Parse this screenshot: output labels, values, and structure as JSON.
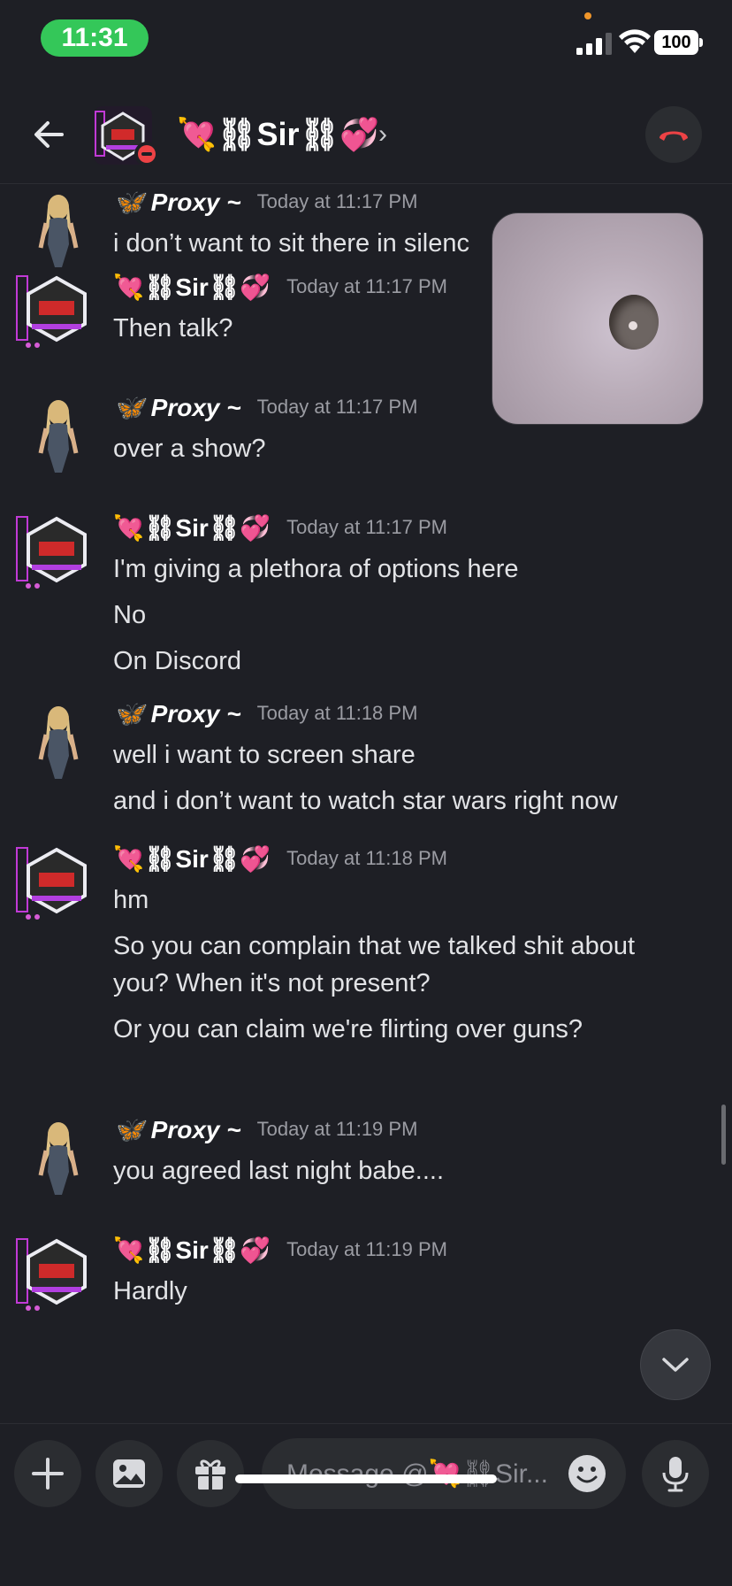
{
  "status_bar": {
    "time": "11:31",
    "battery": "100"
  },
  "header": {
    "title": "💘⛓Sir⛓💞",
    "chevron": "›"
  },
  "colors": {
    "background": "#1e1f25",
    "time_pill": "#34c759",
    "hangup": "#ed4245",
    "surface": "#2b2d31"
  },
  "messages": [
    {
      "user": "🦋 Proxy ~",
      "time": "Today at 11:17 PM",
      "lines": [
        "i don’t want to sit there in silenc"
      ]
    },
    {
      "user": "💘⛓Sir⛓💞",
      "time": "Today at 11:17 PM",
      "lines": [
        "Then talk?"
      ]
    },
    {
      "user": "🦋 Proxy ~",
      "time": "Today at 11:17 PM",
      "lines": [
        "over a show?"
      ]
    },
    {
      "user": "💘⛓Sir⛓💞",
      "time": "Today at 11:17 PM",
      "lines": [
        "I'm giving a plethora of options here",
        "No",
        "On Discord"
      ]
    },
    {
      "user": "🦋 Proxy ~",
      "time": "Today at 11:18 PM",
      "lines": [
        "well i want to screen share",
        "and i don’t want to watch star wars right now"
      ]
    },
    {
      "user": "💘⛓Sir⛓💞",
      "time": "Today at 11:18 PM",
      "lines": [
        "hm",
        "So you can complain that we talked shit about",
        "you? When it's not present?",
        "Or you can claim we're flirting over guns?"
      ]
    },
    {
      "user": "🦋 Proxy ~",
      "time": "Today at 11:19 PM",
      "lines": [
        "you agreed last night babe...."
      ]
    },
    {
      "user": "💘⛓Sir⛓💞",
      "time": "Today at 11:19 PM",
      "lines": [
        "Hardly"
      ]
    }
  ],
  "composer": {
    "placeholder": "Message @💘⛓Sir..."
  },
  "icons": [
    "back-arrow-icon",
    "hangup-icon",
    "plus-icon",
    "image-icon",
    "gift-icon",
    "emoji-icon",
    "microphone-icon",
    "chevron-down-icon"
  ]
}
